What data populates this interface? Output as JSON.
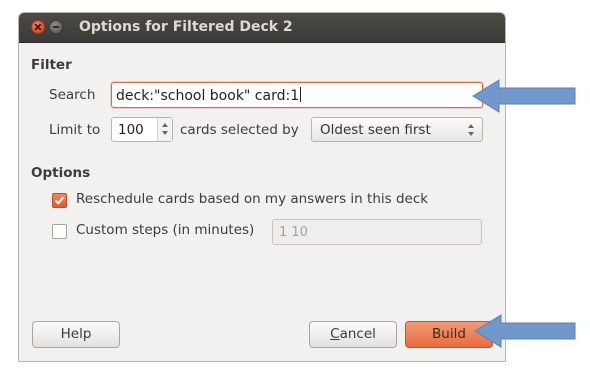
{
  "window": {
    "title": "Options for Filtered Deck 2"
  },
  "filter": {
    "section_label": "Filter",
    "search_label": "Search",
    "search_value": "deck:\"school book\" card:1",
    "limit_label": "Limit to",
    "limit_value": "100",
    "cards_selected_label": "cards selected by",
    "order_selected": "Oldest seen first"
  },
  "options": {
    "section_label": "Options",
    "reschedule_label": "Reschedule cards based on my answers in this deck",
    "reschedule_checked": true,
    "custom_steps_label": "Custom steps (in minutes)",
    "custom_steps_checked": false,
    "custom_steps_value": "1 10"
  },
  "buttons": {
    "help": "Help",
    "cancel_first": "C",
    "cancel_rest": "ancel",
    "build": "Build"
  },
  "colors": {
    "accent": "#e86b3e",
    "arrow": "#6f96c8",
    "titlebar": "#3c3b37"
  },
  "icons": {
    "close": "close-icon",
    "minimize": "minimize-icon",
    "checkmark": "checkmark-icon",
    "annotation_arrow": "arrow-left-icon"
  }
}
